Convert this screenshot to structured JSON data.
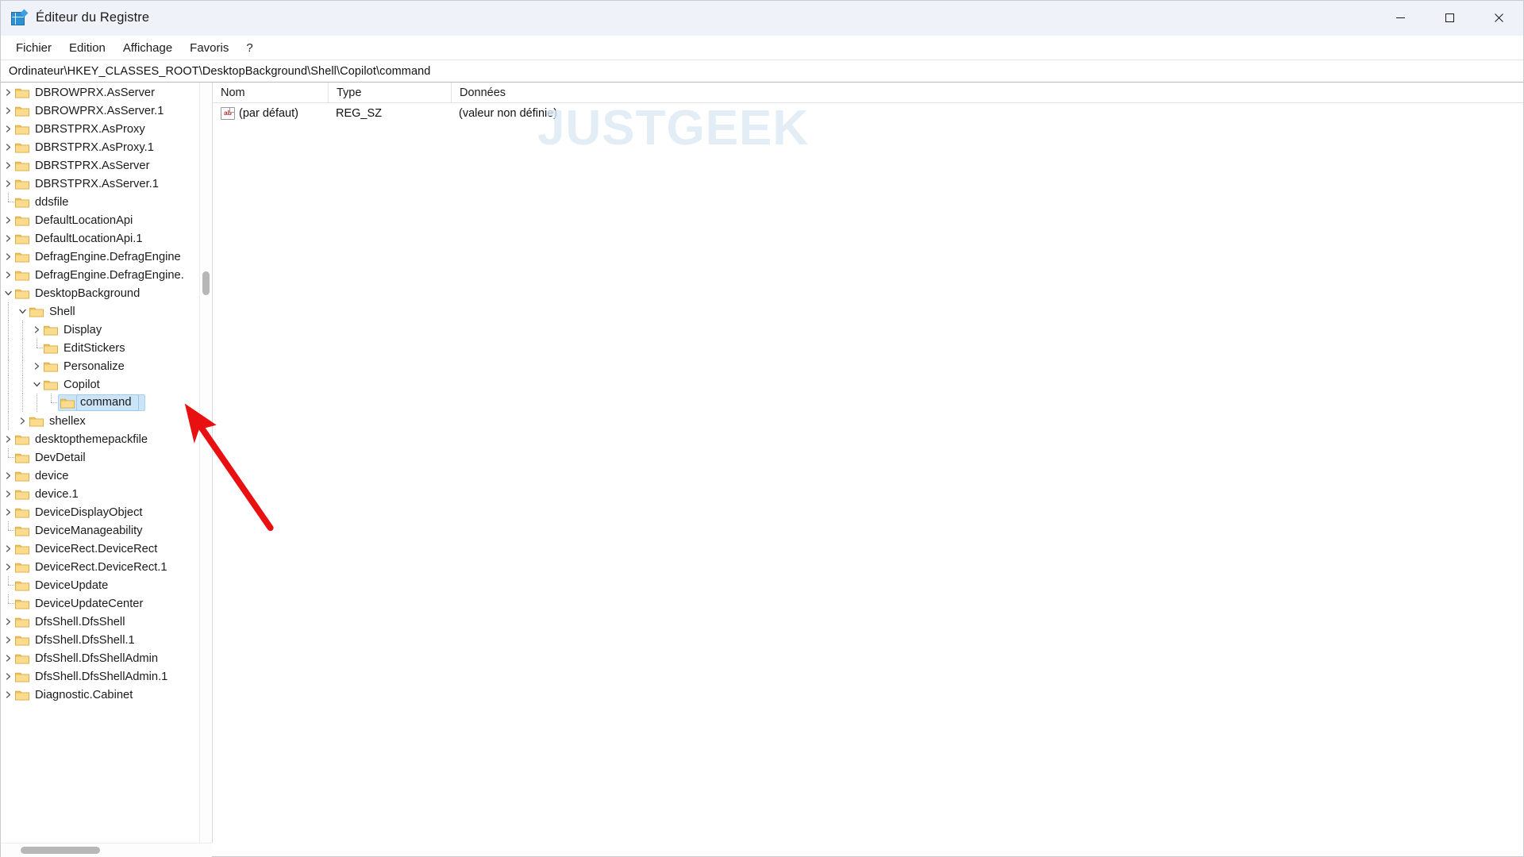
{
  "window": {
    "title": "Éditeur du Registre",
    "icon": "registry-editor-icon",
    "controls": {
      "minimize": "minimize-icon",
      "maximize": "maximize-icon",
      "close": "close-icon"
    }
  },
  "menubar": {
    "items": [
      {
        "label": "Fichier"
      },
      {
        "label": "Edition"
      },
      {
        "label": "Affichage"
      },
      {
        "label": "Favoris"
      },
      {
        "label": "?"
      }
    ]
  },
  "address": {
    "value": "Ordinateur\\HKEY_CLASSES_ROOT\\DesktopBackground\\Shell\\Copilot\\command"
  },
  "watermark": {
    "text": "JUSTGEEK",
    "color": "#dce9f5"
  },
  "tree": {
    "nodes": [
      {
        "label": "DBROWPRX.AsServer",
        "depth": 1,
        "state": "collapsed",
        "selected": false
      },
      {
        "label": "DBROWPRX.AsServer.1",
        "depth": 1,
        "state": "collapsed",
        "selected": false
      },
      {
        "label": "DBRSTPRX.AsProxy",
        "depth": 1,
        "state": "collapsed",
        "selected": false
      },
      {
        "label": "DBRSTPRX.AsProxy.1",
        "depth": 1,
        "state": "collapsed",
        "selected": false
      },
      {
        "label": "DBRSTPRX.AsServer",
        "depth": 1,
        "state": "collapsed",
        "selected": false
      },
      {
        "label": "DBRSTPRX.AsServer.1",
        "depth": 1,
        "state": "collapsed",
        "selected": false
      },
      {
        "label": "ddsfile",
        "depth": 1,
        "state": "leaf",
        "selected": false
      },
      {
        "label": "DefaultLocationApi",
        "depth": 1,
        "state": "collapsed",
        "selected": false
      },
      {
        "label": "DefaultLocationApi.1",
        "depth": 1,
        "state": "collapsed",
        "selected": false
      },
      {
        "label": "DefragEngine.DefragEngine",
        "depth": 1,
        "state": "collapsed",
        "selected": false
      },
      {
        "label": "DefragEngine.DefragEngine.",
        "depth": 1,
        "state": "collapsed",
        "selected": false
      },
      {
        "label": "DesktopBackground",
        "depth": 1,
        "state": "expanded",
        "selected": false
      },
      {
        "label": "Shell",
        "depth": 2,
        "state": "expanded",
        "selected": false
      },
      {
        "label": "Display",
        "depth": 3,
        "state": "collapsed",
        "selected": false
      },
      {
        "label": "EditStickers",
        "depth": 3,
        "state": "leaf",
        "selected": false
      },
      {
        "label": "Personalize",
        "depth": 3,
        "state": "collapsed",
        "selected": false
      },
      {
        "label": "Copilot",
        "depth": 3,
        "state": "expanded",
        "selected": false
      },
      {
        "label": "command",
        "depth": 4,
        "state": "leaf",
        "selected": true
      },
      {
        "label": "shellex",
        "depth": 2,
        "state": "collapsed",
        "selected": false
      },
      {
        "label": "desktopthemepackfile",
        "depth": 1,
        "state": "collapsed",
        "selected": false
      },
      {
        "label": "DevDetail",
        "depth": 1,
        "state": "leaf",
        "selected": false
      },
      {
        "label": "device",
        "depth": 1,
        "state": "collapsed",
        "selected": false
      },
      {
        "label": "device.1",
        "depth": 1,
        "state": "collapsed",
        "selected": false
      },
      {
        "label": "DeviceDisplayObject",
        "depth": 1,
        "state": "collapsed",
        "selected": false
      },
      {
        "label": "DeviceManageability",
        "depth": 1,
        "state": "leaf",
        "selected": false
      },
      {
        "label": "DeviceRect.DeviceRect",
        "depth": 1,
        "state": "collapsed",
        "selected": false
      },
      {
        "label": "DeviceRect.DeviceRect.1",
        "depth": 1,
        "state": "collapsed",
        "selected": false
      },
      {
        "label": "DeviceUpdate",
        "depth": 1,
        "state": "leaf",
        "selected": false
      },
      {
        "label": "DeviceUpdateCenter",
        "depth": 1,
        "state": "leaf",
        "selected": false
      },
      {
        "label": "DfsShell.DfsShell",
        "depth": 1,
        "state": "collapsed",
        "selected": false
      },
      {
        "label": "DfsShell.DfsShell.1",
        "depth": 1,
        "state": "collapsed",
        "selected": false
      },
      {
        "label": "DfsShell.DfsShellAdmin",
        "depth": 1,
        "state": "collapsed",
        "selected": false
      },
      {
        "label": "DfsShell.DfsShellAdmin.1",
        "depth": 1,
        "state": "collapsed",
        "selected": false
      },
      {
        "label": "Diagnostic.Cabinet",
        "depth": 1,
        "state": "collapsed",
        "selected": false
      }
    ]
  },
  "values": {
    "columns": {
      "name": "Nom",
      "type": "Type",
      "data": "Données"
    },
    "rows": [
      {
        "icon": "string-value-icon",
        "name": "(par défaut)",
        "type": "REG_SZ",
        "data": "(valeur non définie)"
      }
    ]
  },
  "annotation": {
    "type": "red-arrow",
    "color": "#e81010",
    "points_to": "command"
  }
}
